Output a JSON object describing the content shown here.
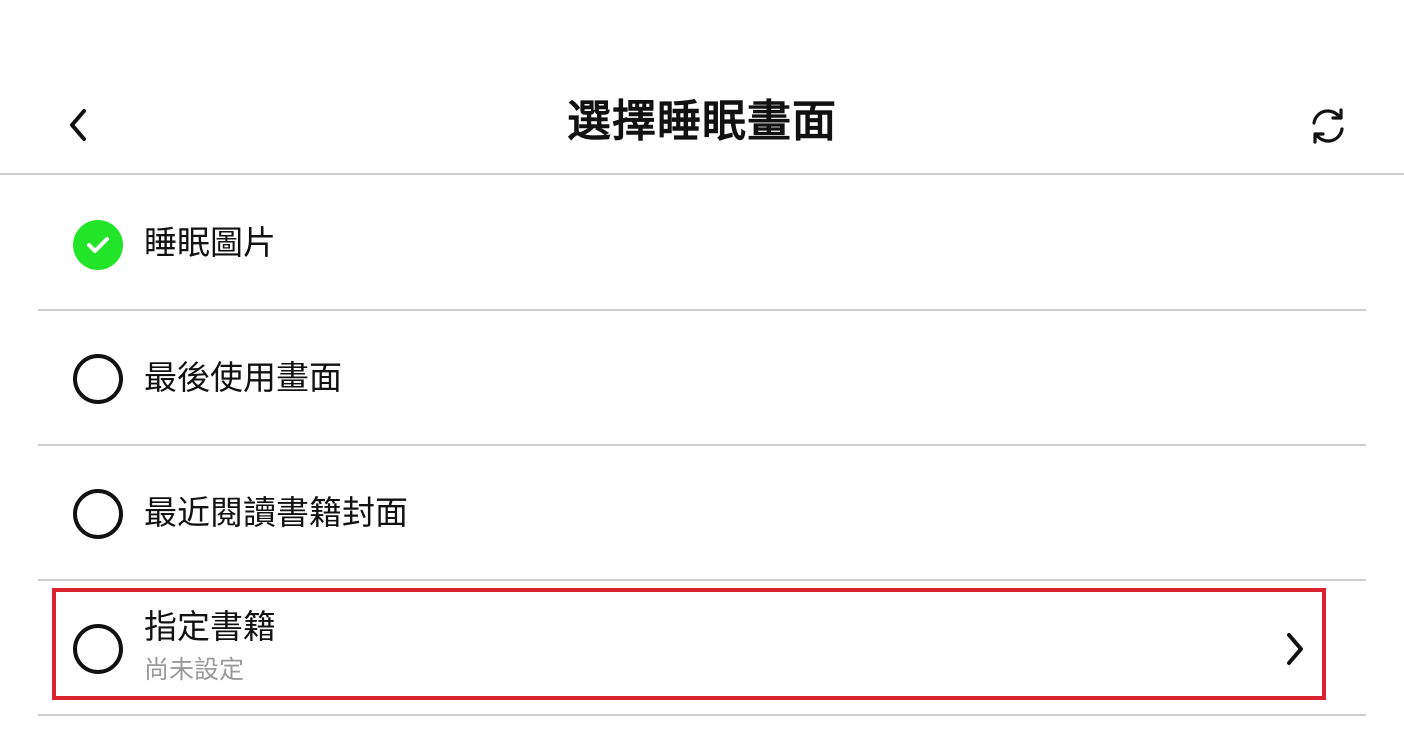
{
  "header": {
    "title": "選擇睡眠畫面",
    "back_icon": "chevron-left-icon",
    "refresh_icon": "refresh-icon"
  },
  "options": [
    {
      "label": "睡眠圖片",
      "selected": true,
      "icon": "check-circle-icon"
    },
    {
      "label": "最後使用畫面",
      "selected": false,
      "icon": "radio-empty-icon"
    },
    {
      "label": "最近閱讀書籍封面",
      "selected": false,
      "icon": "radio-empty-icon"
    },
    {
      "label": "指定書籍",
      "sublabel": "尚未設定",
      "selected": false,
      "icon": "radio-empty-icon",
      "trailing_icon": "chevron-right-icon"
    }
  ],
  "colors": {
    "selected_green": "#22e52a",
    "highlight_red": "#d9232e",
    "divider": "#cfcfcf",
    "sublabel_gray": "#9a9a9a"
  }
}
